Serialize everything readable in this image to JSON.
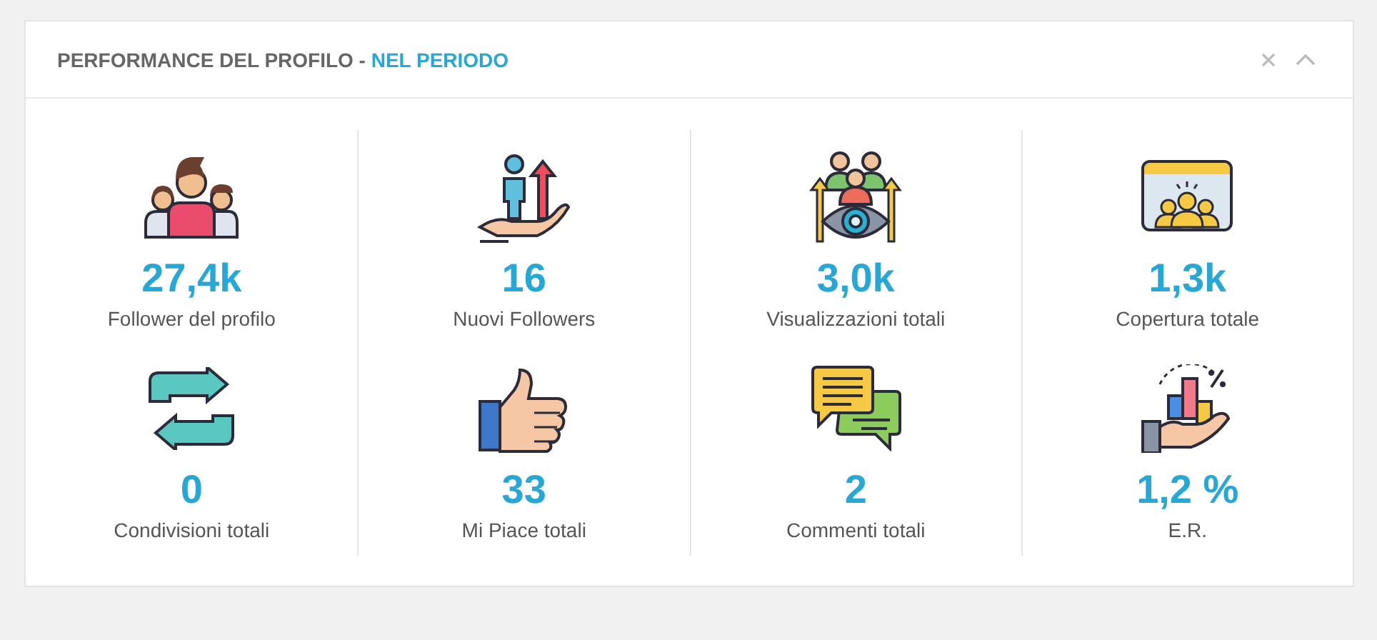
{
  "panel": {
    "title": "PERFORMANCE DEL PROFILO - ",
    "title_highlight": "NEL PERIODO"
  },
  "stats": [
    {
      "kind": "people",
      "value": "27,4k",
      "label": "Follower del profilo"
    },
    {
      "kind": "growth",
      "value": "16",
      "label": "Nuovi Followers"
    },
    {
      "kind": "views",
      "value": "3,0k",
      "label": "Visualizzazioni totali"
    },
    {
      "kind": "audience",
      "value": "1,3k",
      "label": "Copertura totale"
    },
    {
      "kind": "share",
      "value": "0",
      "label": "Condivisioni totali"
    },
    {
      "kind": "like",
      "value": "33",
      "label": "Mi Piace totali"
    },
    {
      "kind": "comments",
      "value": "2",
      "label": "Commenti totali"
    },
    {
      "kind": "rate",
      "value": "1,2 %",
      "label": "E.R."
    }
  ]
}
